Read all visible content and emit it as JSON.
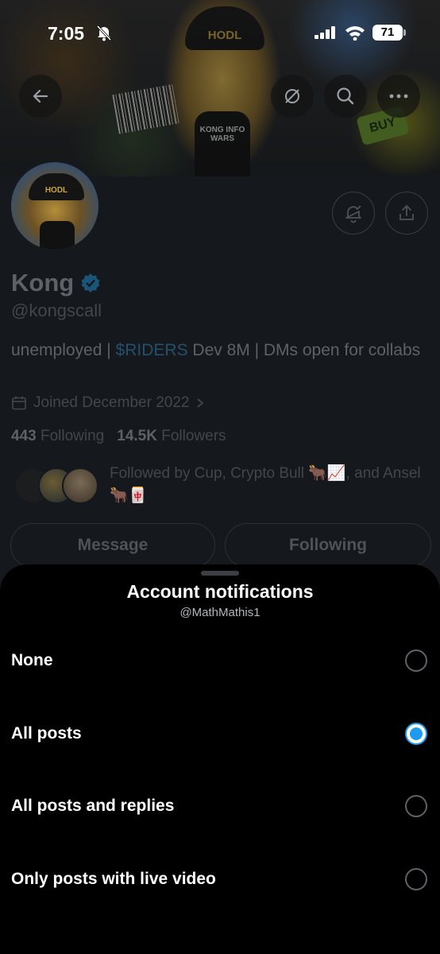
{
  "status_bar": {
    "time": "7:05",
    "battery": "71"
  },
  "header_actions": {
    "back_icon": "arrow-left-icon",
    "sync_icon": "no-sync-icon",
    "search_icon": "search-icon",
    "more_icon": "more-dots-icon"
  },
  "banner": {
    "cap_text": "HODL",
    "shirt_text": "KONG INFO WARS",
    "sign_text": "BUY"
  },
  "profile": {
    "avatar_cap_text": "HODL",
    "name": "Kong",
    "handle": "@kongscall",
    "bio_prefix": "unemployed | ",
    "bio_cashtag": "$RIDERS",
    "bio_suffix": " Dev 8M | DMs open for collabs",
    "joined": "Joined December 2022",
    "following_count": "443",
    "following_label": "Following",
    "followers_count": "14.5K",
    "followers_label": "Followers",
    "followed_by": "Followed by Cup, Crypto Bull 🐂📈, and Ansel 🐂🀄",
    "message_button": "Message",
    "following_button": "Following"
  },
  "sheet": {
    "title": "Account notifications",
    "subtitle": "@MathMathis1",
    "options": [
      {
        "label": "None",
        "selected": false
      },
      {
        "label": "All posts",
        "selected": true
      },
      {
        "label": "All posts and replies",
        "selected": false
      },
      {
        "label": "Only posts with live video",
        "selected": false
      }
    ]
  },
  "colors": {
    "accent": "#1d9bf0",
    "sheet_bg": "#000000",
    "profile_bg": "#15181c"
  }
}
